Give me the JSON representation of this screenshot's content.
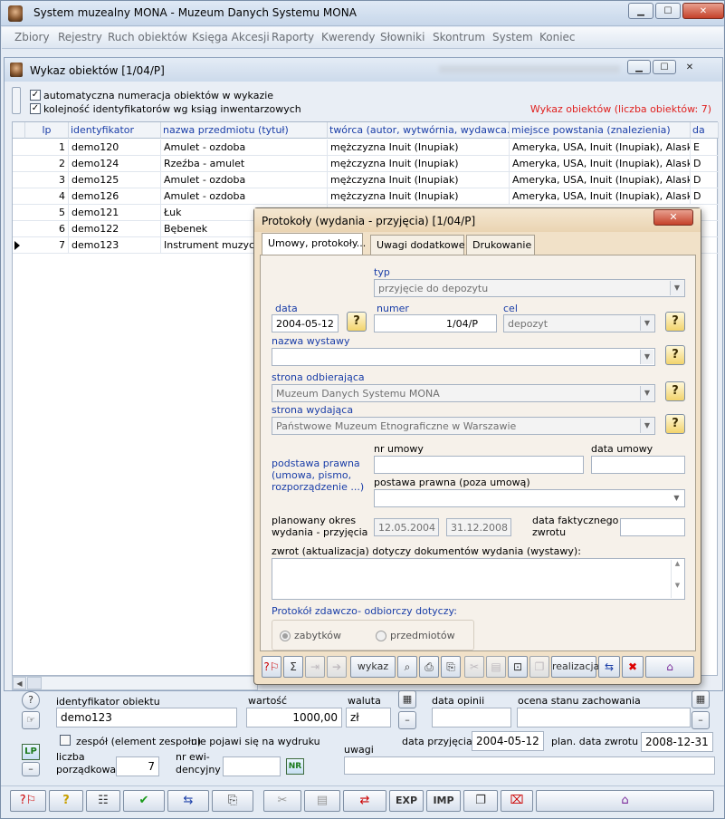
{
  "app": {
    "title": "System muzealny MONA   -   Muzeum Danych Systemu MONA"
  },
  "window_buttons": {
    "min": "▁",
    "max": "☐",
    "close": "✕"
  },
  "menu": [
    "Zbiory",
    "Rejestry",
    "Ruch obiektów",
    "Księga Akcesji",
    "Raporty",
    "Kwerendy",
    "Słowniki",
    "Skontrum",
    "System",
    "Koniec"
  ],
  "child": {
    "title": "Wykaz obiektów [1/04/P]",
    "option_auto_numbering": "automatyczna numeracja obiektów w wykazie",
    "option_order": "kolejność identyfikatorów wg ksiąg inwentarzowych",
    "count_label": "Wykaz obiektów (liczba obiektów: 7)",
    "columns": [
      "lp",
      "identyfikator",
      "nazwa przedmiotu (tytuł)",
      "twórca (autor, wytwórnia, wydawca...)",
      "miejsce powstania (znalezienia)",
      "da"
    ],
    "rows": [
      {
        "lp": "1",
        "id": "demo120",
        "name": "Amulet - ozdoba",
        "creator": "mężczyzna Inuit (Inupiak)",
        "place": "Ameryka, USA, Inuit (Inupiak), Alaska, Nc",
        "date": "E"
      },
      {
        "lp": "2",
        "id": "demo124",
        "name": "Rzeźba - amulet",
        "creator": "mężczyzna Inuit (Inupiak)",
        "place": "Ameryka, USA, Inuit (Inupiak), Alaska, Nc",
        "date": "D"
      },
      {
        "lp": "3",
        "id": "demo125",
        "name": "Amulet - ozdoba",
        "creator": "mężczyzna Inuit (Inupiak)",
        "place": "Ameryka, USA, Inuit (Inupiak), Alaska, Nc",
        "date": "D"
      },
      {
        "lp": "4",
        "id": "demo126",
        "name": "Amulet - ozdoba",
        "creator": "mężczyzna Inuit (Inupiak)",
        "place": "Ameryka, USA, Inuit (Inupiak), Alaska, Nc",
        "date": "D"
      },
      {
        "lp": "5",
        "id": "demo121",
        "name": "Łuk",
        "creator": "",
        "place": "",
        "date": ""
      },
      {
        "lp": "6",
        "id": "demo122",
        "name": "Bębenek",
        "creator": "",
        "place": "",
        "date": ""
      },
      {
        "lp": "7",
        "id": "demo123",
        "name": "Instrument muzyczny",
        "creator": "",
        "place": "",
        "date": ""
      }
    ]
  },
  "detail": {
    "id_label": "identyfikator obiektu",
    "id_value": "demo123",
    "value_label": "wartość",
    "value_value": "1000,00",
    "currency_label": "waluta",
    "currency_value": "zł",
    "opinion_date_label": "data opinii",
    "condition_label": "ocena stanu zachowania",
    "set_label": "zespół (element zespołu)",
    "not_printed_label": "nie pojawi się na wydruku",
    "ordinal_label_1": "liczba",
    "ordinal_label_2": "porządkowa",
    "ordinal_value": "7",
    "rec_label_1": "nr ewi-",
    "rec_label_2": "dencyjny",
    "nr_button": "NR",
    "lp_button": "LP",
    "notes_label": "uwagi",
    "accept_date_label": "data przyjęcia",
    "accept_date_value": "2004-05-12",
    "return_plan_label": "plan. data zwrotu",
    "return_plan_value": "2008-12-31"
  },
  "toolbar": {
    "exp": "EXP",
    "imp": "IMP"
  },
  "dialog": {
    "title": "Protokoły (wydania - przyjęcia) [1/04/P]",
    "close": "✕",
    "tabs": [
      "Umowy, protokoły...",
      "Uwagi dodatkowe",
      "Drukowanie"
    ],
    "type_label": "typ",
    "type_value": "przyjęcie do depozytu",
    "date_label": "data",
    "date_value": "2004-05-12",
    "number_label": "numer",
    "number_value": "1/04/P",
    "purpose_label": "cel",
    "purpose_value": "depozyt",
    "exhibition_label": "nazwa wystawy",
    "exhibition_value": "",
    "receiving_label": "strona odbierająca",
    "receiving_value": "Muzeum Danych Systemu MONA",
    "issuing_label": "strona wydająca",
    "issuing_value": "Państwowe Muzeum Etnograficzne w Warszawie",
    "legal_basis_label_1": "podstawa prawna",
    "legal_basis_label_2": "(umowa, pismo,",
    "legal_basis_label_3": "rozporządzenie ...)",
    "contract_no_label": "nr umowy",
    "contract_date_label": "data umowy",
    "legal_basis_other_label": "postawa prawna (poza umową)",
    "period_label_1": "planowany okres",
    "period_label_2": "wydania - przyjęcia",
    "period_from": "12.05.2004",
    "period_to": "31.12.2008",
    "actual_return_label_1": "data faktycznego",
    "actual_return_label_2": "zwrotu",
    "return_docs_label": "zwrot (aktualizacja) dotyczy dokumentów wydania (wystawy):",
    "protocol_label": "Protokół zdawczo- odbiorczy dotyczy:",
    "radio_items": "zabytków",
    "radio_objects": "przedmiotów",
    "btn_wykaz": "wykaz",
    "btn_realizacja": "realizacja"
  }
}
